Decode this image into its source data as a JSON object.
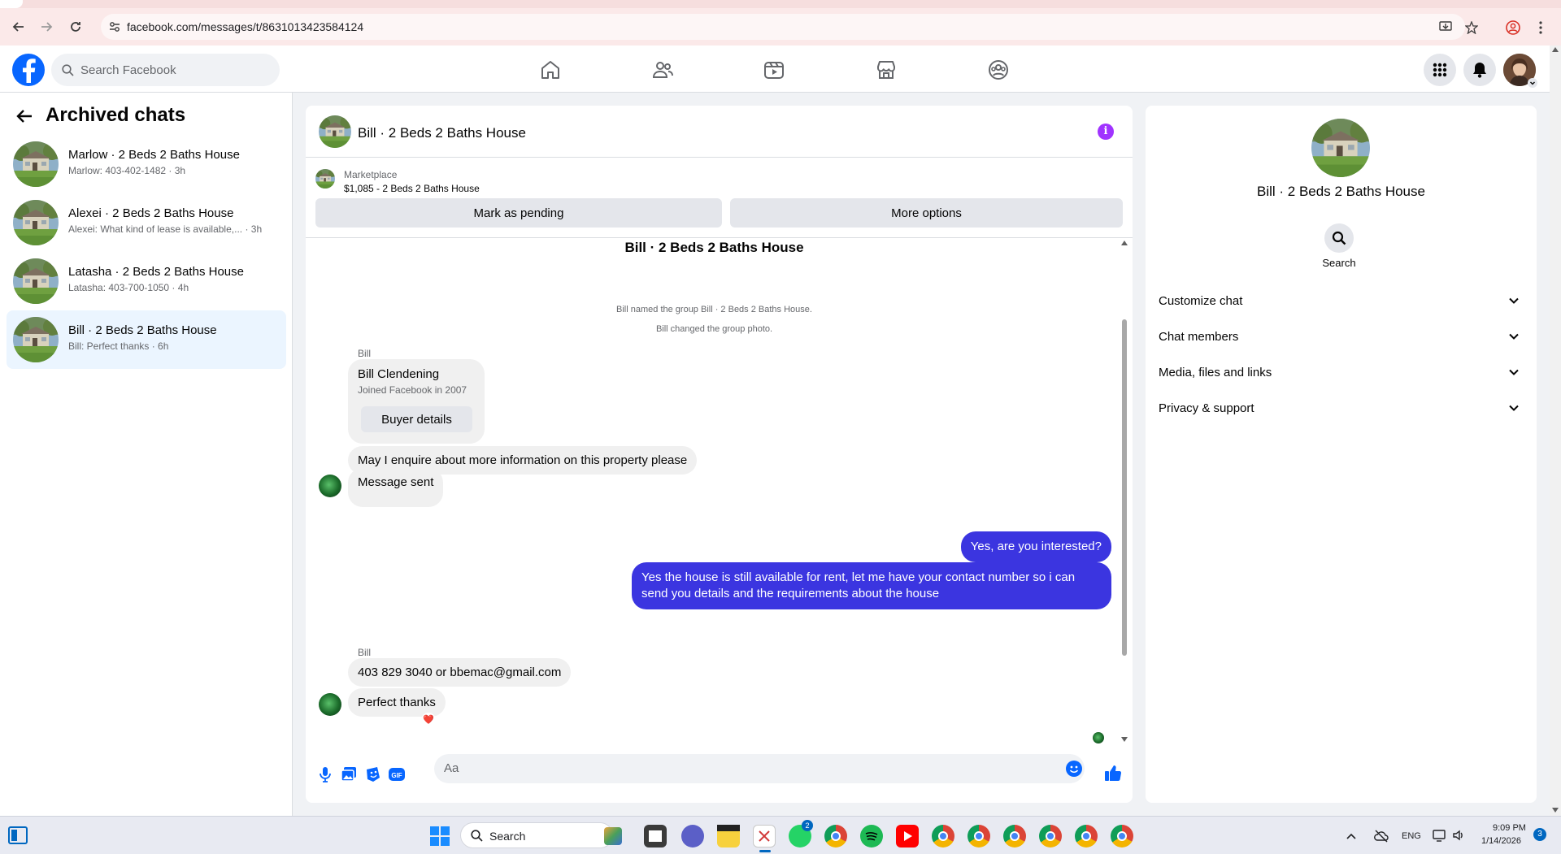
{
  "browser": {
    "url": "facebook.com/messages/t/8631013423584124"
  },
  "header": {
    "search_placeholder": "Search Facebook",
    "nav_icons": [
      "home-icon",
      "friends-icon",
      "video-icon",
      "marketplace-icon",
      "groups-icon"
    ],
    "right_icons": [
      "menu-grid-icon",
      "bell-icon",
      "profile-avatar"
    ]
  },
  "sidebar": {
    "title": "Archived chats",
    "chats": [
      {
        "name": "Marlow · 2 Beds 2 Baths House",
        "preview": "Marlow: 403-402-1482 · 3h"
      },
      {
        "name": "Alexei · 2 Beds 2 Baths House",
        "preview": "Alexei: What kind of lease is available,... · 3h"
      },
      {
        "name": "Latasha · 2 Beds 2 Baths House",
        "preview": "Latasha: 403-700-1050 · 4h"
      },
      {
        "name": "Bill · 2 Beds 2 Baths House",
        "preview": "Bill: Perfect thanks · 6h"
      }
    ]
  },
  "chat": {
    "title": "Bill · 2 Beds 2 Baths House",
    "marketplace": {
      "label": "Marketplace",
      "listing": "$1,085 - 2 Beds 2 Baths House",
      "pending_button": "Mark as pending",
      "options_button": "More options"
    },
    "thread_title": "Bill · 2 Beds 2 Baths House",
    "system_messages": [
      "Bill named the group Bill · 2 Beds 2 Baths House.",
      "Bill changed the group photo."
    ],
    "sender_name": "Bill",
    "buyer_card": {
      "name": "Bill Clendening",
      "joined": "Joined Facebook in 2007",
      "button": "Buyer details"
    },
    "messages_in_1": [
      "May I enquire about more information on this property please",
      "Message sent"
    ],
    "messages_out": [
      "Yes, are you interested?",
      "Yes the house is still available for rent, let me have your contact number so i can send you details and the requirements about the house"
    ],
    "messages_in_2": [
      "403 829 3040 or bbemac@gmail.com",
      "Perfect thanks"
    ],
    "reaction": "❤️",
    "composer_placeholder": "Aa"
  },
  "details": {
    "name": "Bill · 2 Beds 2 Baths House",
    "search_label": "Search",
    "sections": [
      "Customize chat",
      "Chat members",
      "Media, files and links",
      "Privacy & support"
    ]
  },
  "taskbar": {
    "search_placeholder": "Search",
    "whatsapp_badge": "2",
    "language": "ENG",
    "time": "9:09 PM",
    "date": "1/14/2026",
    "notification_count": "3"
  },
  "colors": {
    "facebook_blue": "#0866ff",
    "outgoing_bubble": "#3b35e0",
    "info_purple": "#a033ff",
    "active_chat_bg": "#ebf5ff"
  }
}
